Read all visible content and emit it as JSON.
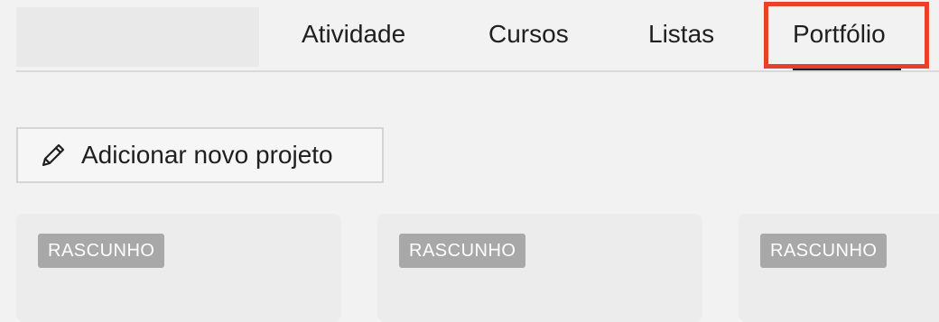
{
  "tabs": [
    {
      "label": "Atividade"
    },
    {
      "label": "Cursos"
    },
    {
      "label": "Listas"
    },
    {
      "label": "Portfólio",
      "active": true
    }
  ],
  "actions": {
    "add_project_label": "Adicionar novo projeto",
    "add_project_icon": "pencil-icon"
  },
  "projects": [
    {
      "status": "RASCUNHO"
    },
    {
      "status": "RASCUNHO"
    },
    {
      "status": "RASCUNHO"
    }
  ],
  "colors": {
    "highlight": "#e8402a",
    "badge_bg": "#a8a8a8",
    "active_underline": "#1f1f1f"
  }
}
